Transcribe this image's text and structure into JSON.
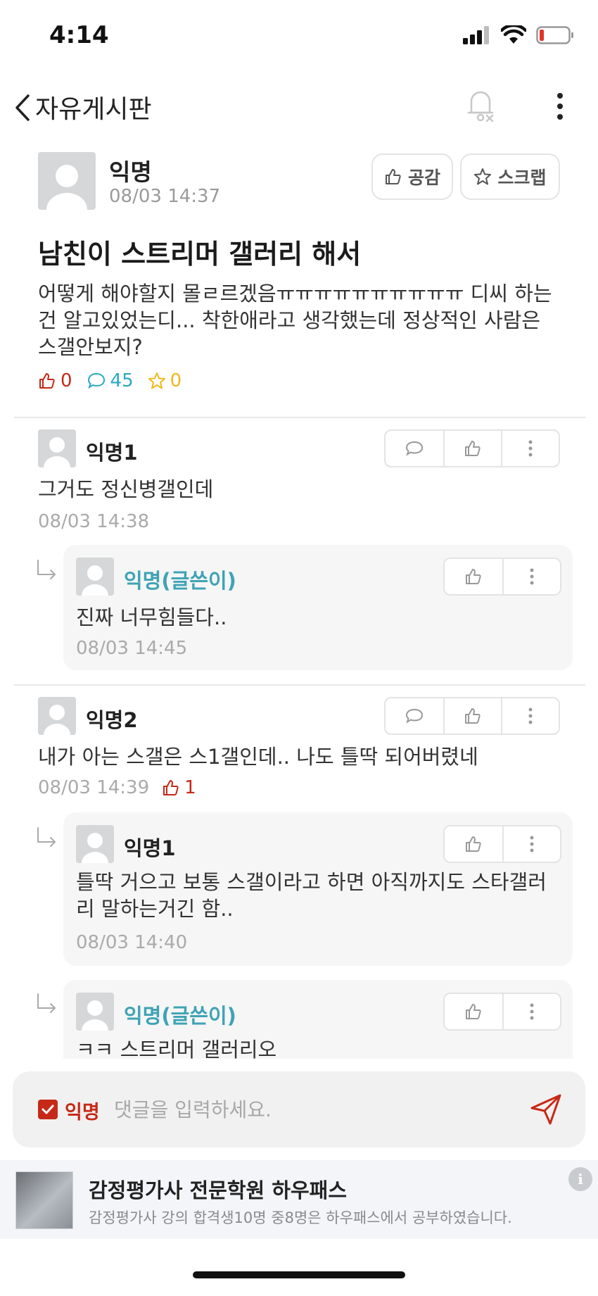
{
  "status_bar": {
    "time": "4:14"
  },
  "nav": {
    "title": "자유게시판"
  },
  "post": {
    "author": "익명",
    "date": "08/03 14:37",
    "like_button": "공감",
    "scrap_button": "스크랩",
    "title": "남친이 스트리머 갤러리 해서",
    "body": "어떻게 해야할지 몰ㄹ르겠음ㅠㅠㅠㅠㅠㅠㅠㅠㅠㅠ 디씨 하는 건 알고있었는디... 착한애라고 생각했는데 정상적인 사람은 스갤안보지?",
    "likes": "0",
    "comments": "45",
    "scraps": "0"
  },
  "comments": [
    {
      "author": "익명1",
      "text": "그거도 정신병갤인데",
      "date": "08/03 14:38"
    },
    {
      "author": "익명(글쓴이)",
      "text": "진짜 너무힘들다..",
      "date": "08/03 14:45"
    },
    {
      "author": "익명2",
      "text": "내가 아는 스갤은  스1갤인데.. 나도 틀딱 되어버렸네",
      "date": "08/03 14:39",
      "votes": "1"
    },
    {
      "author": "익명1",
      "text": "틀딱 거으고 보통 스갤이라고 하면 아직까지도 스타갤러리 말하는거긴 함..",
      "date": "08/03 14:40"
    },
    {
      "author": "익명(글쓴이)",
      "text": "ㅋㅋ 스트리머 갤러리오"
    }
  ],
  "input": {
    "anon_label": "익명",
    "placeholder": "댓글을 입력하세요."
  },
  "ad": {
    "title": "감정평가사 전문학원 하우패스",
    "description": "감정평가사 강의 합격생10명 중8명은 하우패스에서 공부하였습니다.",
    "info": "i"
  },
  "colors": {
    "accent_red": "#c62917",
    "op_teal": "#3fa3b5",
    "comment_blue": "#2aa8c4",
    "scrap_yellow": "#f1b81c"
  }
}
